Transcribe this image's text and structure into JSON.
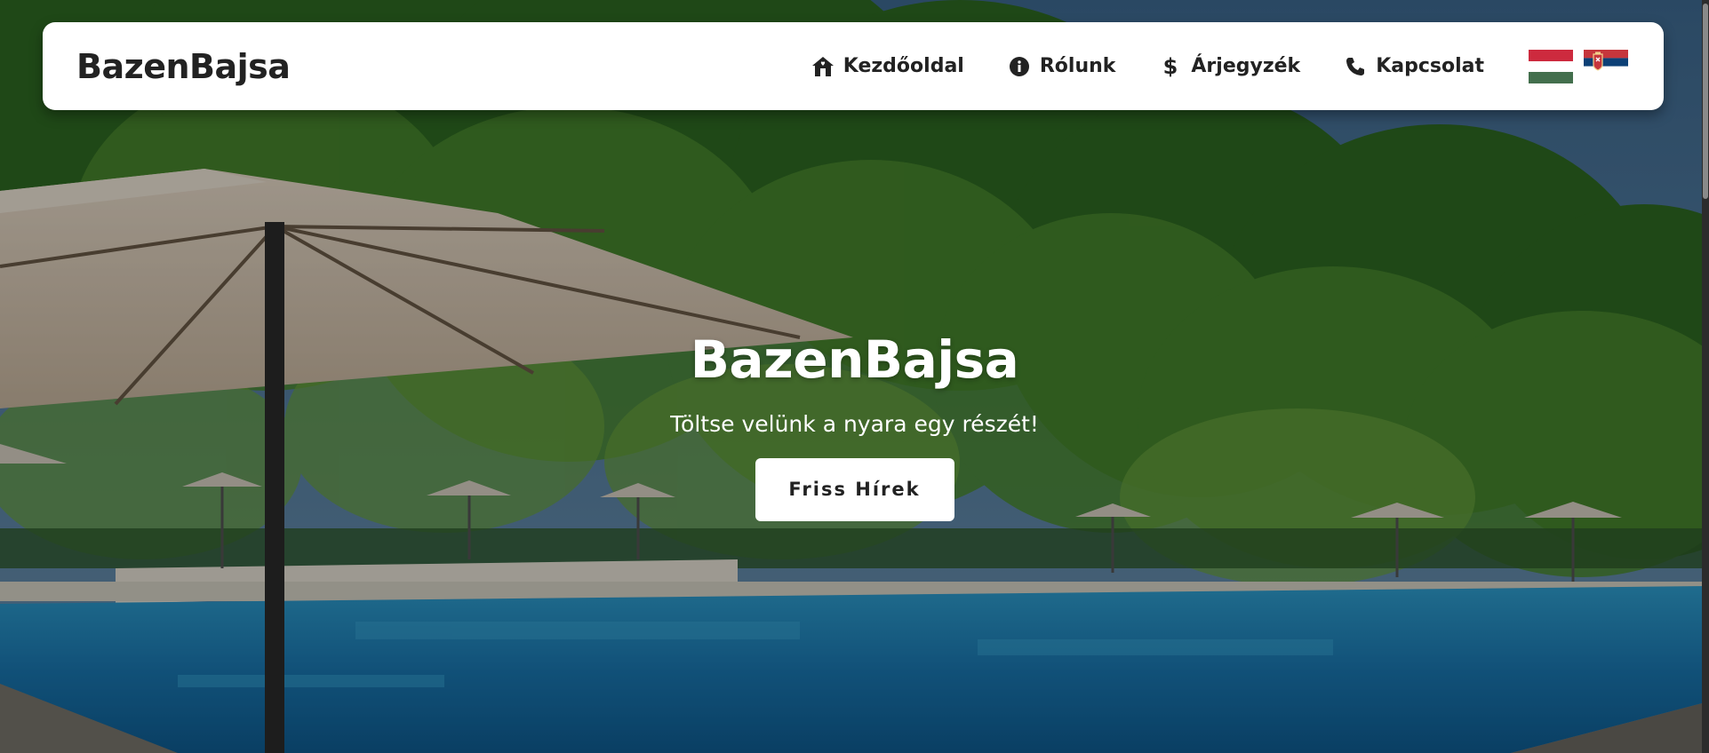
{
  "brand": {
    "logo": "BazenBajsa"
  },
  "nav": {
    "items": [
      {
        "label": "Kezdőoldal",
        "icon": "home-icon"
      },
      {
        "label": "Rólunk",
        "icon": "info-icon"
      },
      {
        "label": "Árjegyzék",
        "icon": "dollar-icon"
      },
      {
        "label": "Kapcsolat",
        "icon": "phone-icon"
      }
    ],
    "languages": [
      {
        "code": "hu",
        "icon": "hungary-flag-icon"
      },
      {
        "code": "sr",
        "icon": "serbia-flag-icon"
      }
    ]
  },
  "hero": {
    "title": "BazenBajsa",
    "subtitle": "Töltse velünk a nyara egy részét!",
    "button_label": "Friss Hírek"
  },
  "colors": {
    "navbar_bg": "#ffffff",
    "text_dark": "#222222",
    "pool_blue": "#1e7fb8",
    "foliage": "#3f7a2c"
  }
}
